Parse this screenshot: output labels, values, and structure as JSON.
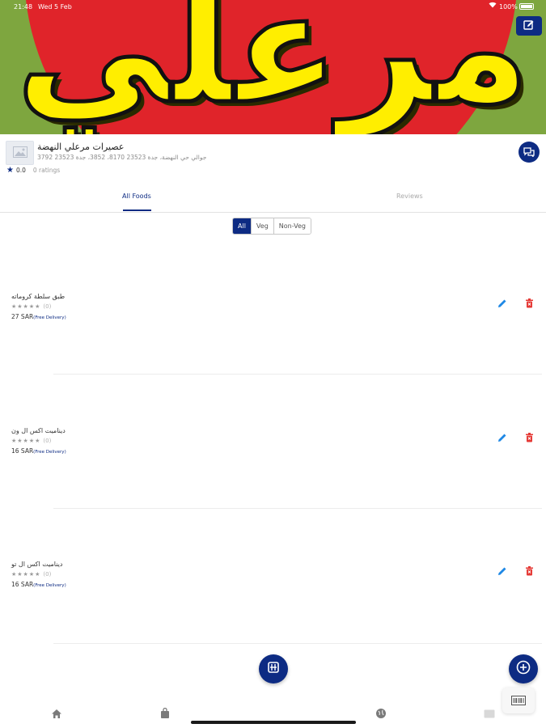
{
  "status_bar": {
    "time": "21:48",
    "date": "Wed 5 Feb",
    "battery": "100%"
  },
  "banner": {
    "logo_text": "مرعلي",
    "colors": {
      "background": "#7ea63f",
      "disc": "#e0242a",
      "text": "#ffee00"
    }
  },
  "store": {
    "name": "عصيرات مرعلي النهضة",
    "address": "جوالي حي النهضة، جدة 23523 8170، 3852، جدة 23523 3792",
    "rating": "0.0",
    "rating_count": "0 ratings"
  },
  "tabs": [
    {
      "label": "All Foods",
      "active": true
    },
    {
      "label": "Reviews",
      "active": false
    }
  ],
  "filter": {
    "options": [
      "All",
      "Veg",
      "Non-Veg"
    ],
    "selected": "All"
  },
  "foods": [
    {
      "name": "طبق سلطة كروماته",
      "stars": "★★★★★",
      "rating_count": "(0)",
      "price": "27 SAR",
      "delivery": "(Free Delivery)"
    },
    {
      "name": "ديناميت اكس ال ون",
      "stars": "★★★★★",
      "rating_count": "(0)",
      "price": "16 SAR",
      "delivery": "(Free Delivery)"
    },
    {
      "name": "ديناميت اكس ال تو",
      "stars": "★★★★★",
      "rating_count": "(0)",
      "price": "16 SAR",
      "delivery": "(Free Delivery)"
    }
  ],
  "icons": {
    "edit_banner": "edit-square-icon",
    "chat": "chat-icon",
    "edit": "pencil-icon",
    "delete": "trash-icon",
    "center_fab": "restaurant-menu-icon",
    "add_fab": "plus-circle-icon",
    "barcode": "barcode-icon",
    "nav": [
      "home-icon",
      "shopping-bag-icon",
      "globe-icon",
      "card-icon"
    ]
  },
  "theme": {
    "primary": "#0d2b83",
    "danger": "#e53935",
    "edit": "#1e88e5"
  }
}
